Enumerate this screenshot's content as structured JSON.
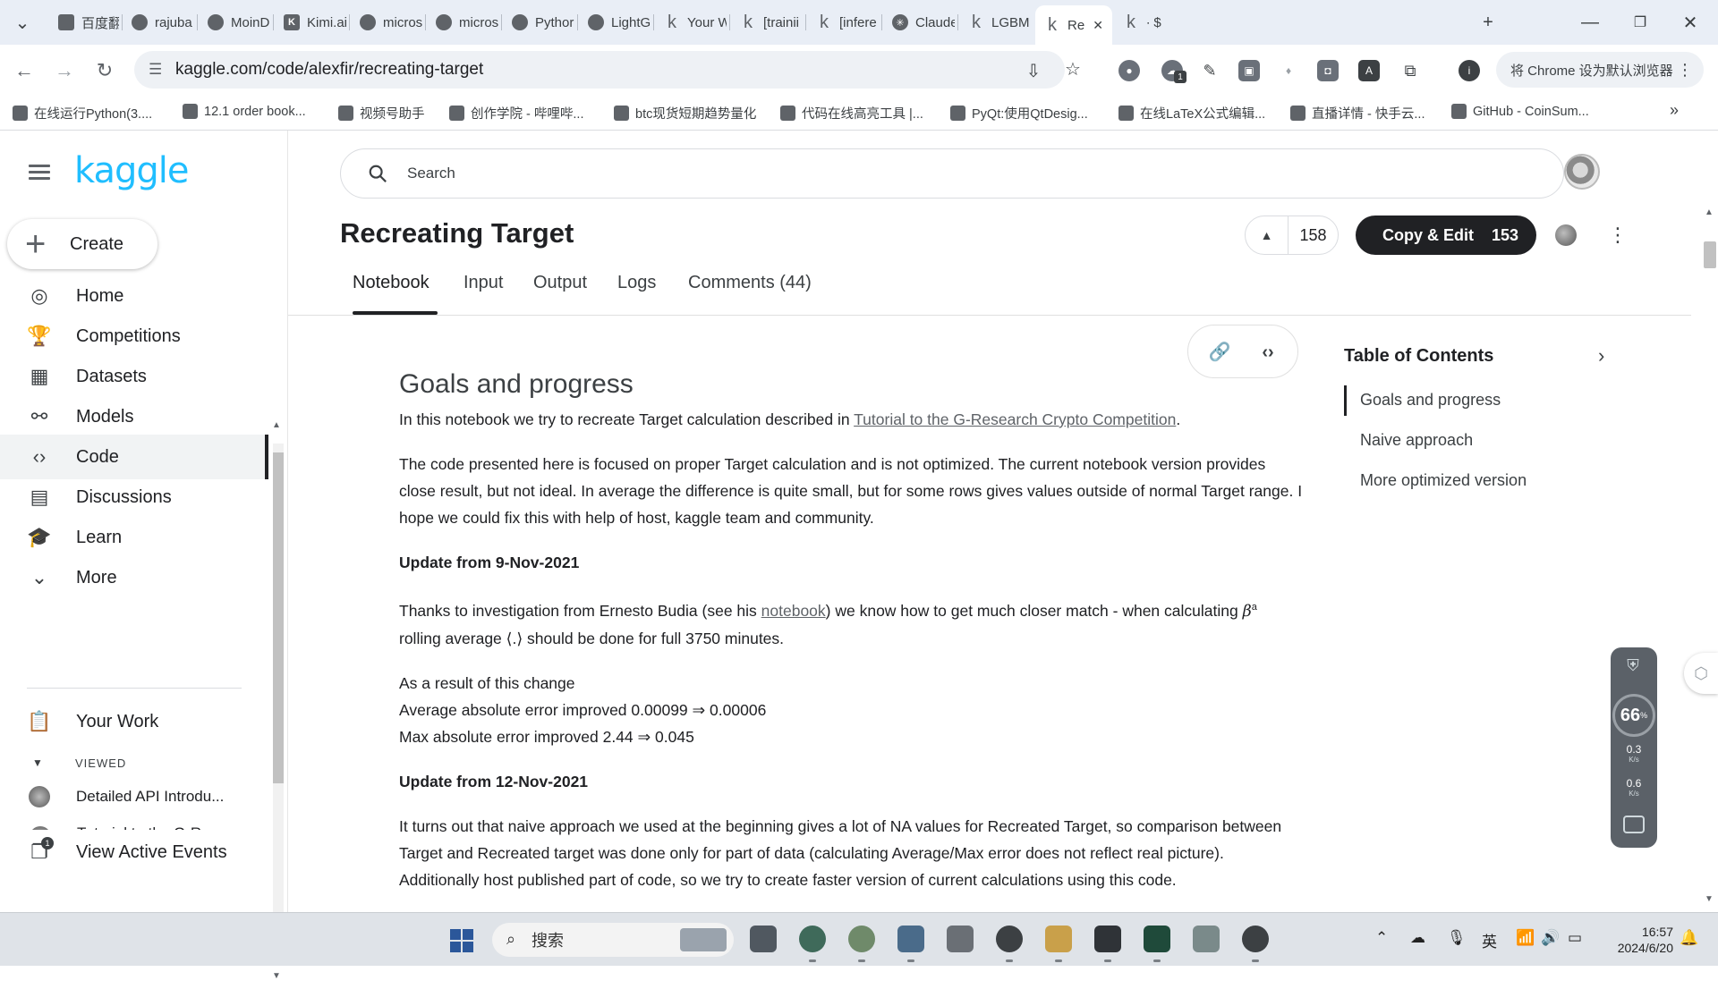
{
  "browser": {
    "tabs": [
      {
        "label": "百度翻",
        "icon": "baidu-translate-icon"
      },
      {
        "label": "rajuba",
        "icon": "github-icon"
      },
      {
        "label": "MoinD",
        "icon": "github-icon"
      },
      {
        "label": "Kimi.ai",
        "icon": "kimi-icon"
      },
      {
        "label": "micros",
        "icon": "github-icon"
      },
      {
        "label": "micros",
        "icon": "github-icon"
      },
      {
        "label": "Pythor",
        "icon": "document-icon"
      },
      {
        "label": "LightG",
        "icon": "github-icon"
      },
      {
        "label": "Your W",
        "icon": "kaggle-icon"
      },
      {
        "label": "[trainii",
        "icon": "kaggle-icon"
      },
      {
        "label": "[infere",
        "icon": "kaggle-icon"
      },
      {
        "label": "Claude",
        "icon": "claude-icon"
      },
      {
        "label": "LGBM",
        "icon": "kaggle-icon"
      },
      {
        "label": "Re",
        "icon": "kaggle-icon",
        "active": true
      },
      {
        "label": "∙ $",
        "icon": "kaggle-icon"
      }
    ],
    "url": "kaggle.com/code/alexfir/recreating-target",
    "default_browser_label": "将 Chrome 设为默认浏览器",
    "extension_badge": "1",
    "bookmarks": [
      "在线运行Python(3....",
      "12.1 order book...",
      "视频号助手",
      "创作学院 - 哔哩哔...",
      "btc现货短期趋势量化",
      "代码在线高亮工具 |...",
      "PyQt:使用QtDesig...",
      "在线LaTeX公式编辑...",
      "直播详情 - 快手云...",
      "GitHub - CoinSum..."
    ]
  },
  "kaggle": {
    "logo": "kaggle",
    "create_label": "Create",
    "nav": [
      {
        "label": "Home",
        "icon": "compass-icon"
      },
      {
        "label": "Competitions",
        "icon": "trophy-icon"
      },
      {
        "label": "Datasets",
        "icon": "table-icon"
      },
      {
        "label": "Models",
        "icon": "models-icon"
      },
      {
        "label": "Code",
        "icon": "code-icon",
        "active": true
      },
      {
        "label": "Discussions",
        "icon": "discussion-icon"
      },
      {
        "label": "Learn",
        "icon": "graduation-cap-icon"
      },
      {
        "label": "More",
        "icon": "chevron-down-icon"
      }
    ],
    "your_work_label": "Your Work",
    "viewed_label": "VIEWED",
    "viewed_items": [
      "Detailed API Introdu...",
      "Tutorial to the G-Re..."
    ],
    "view_active_events_label": "View Active Events",
    "view_active_events_badge": "1",
    "search_placeholder": "Search"
  },
  "notebook": {
    "title": "Recreating Target",
    "upvotes": "158",
    "copy_edit_label": "Copy & Edit",
    "copy_edit_count": "153",
    "tabs": [
      "Notebook",
      "Input",
      "Output",
      "Logs",
      "Comments (44)"
    ],
    "active_tab": "Notebook",
    "heading": "Goals and progress",
    "intro_prefix": "In this notebook we try to recreate Target calculation described in ",
    "intro_link": "Tutorial to the G-Research Crypto Competition",
    "intro_suffix": ".",
    "para2": "The code presented here is focused on proper Target calculation and is not optimized. The current notebook version provides close result, but not ideal. In average the difference is quite small, but for some rows gives values outside of normal Target range. I hope we could fix this with help of host, kaggle team and community.",
    "update1_title": "Update from 9-Nov-2021",
    "update1_prefix": "Thanks to investigation from Ernesto Budia (see his ",
    "update1_link": "notebook",
    "update1_suffix": ") we know how to get much closer match - when calculating ",
    "update1_beta": "β",
    "update1_sup": "a",
    "update1_rest": " rolling average ⟨.⟩ should be done for full 3750 minutes.",
    "result_lines": [
      "As a result of this change",
      "Average absolute error improved 0.00099 ⇒ 0.00006",
      "Max absolute error improved 2.44 ⇒ 0.045"
    ],
    "update2_title": "Update from 12-Nov-2021",
    "update2_text": "It turns out that naive approach we used at the beginning gives a lot of NA values for Recreated Target, so comparison between Target and Recreated target was done only for part of data (calculating Average/Max error does not reflect real picture). Additionally host published part of code, so we try to create faster version of current calculations using this code."
  },
  "toc": {
    "title": "Table of Contents",
    "items": [
      "Goals and progress",
      "Naive approach",
      "More optimized version"
    ]
  },
  "net_monitor": {
    "percent": "66",
    "percent_unit": "%",
    "up_value": "0.3",
    "up_unit": "K/s",
    "down_value": "0.6",
    "down_unit": "K/s"
  },
  "taskbar": {
    "search_label": "搜索",
    "ime": "英",
    "time": "16:57",
    "date": "2024/6/20"
  }
}
